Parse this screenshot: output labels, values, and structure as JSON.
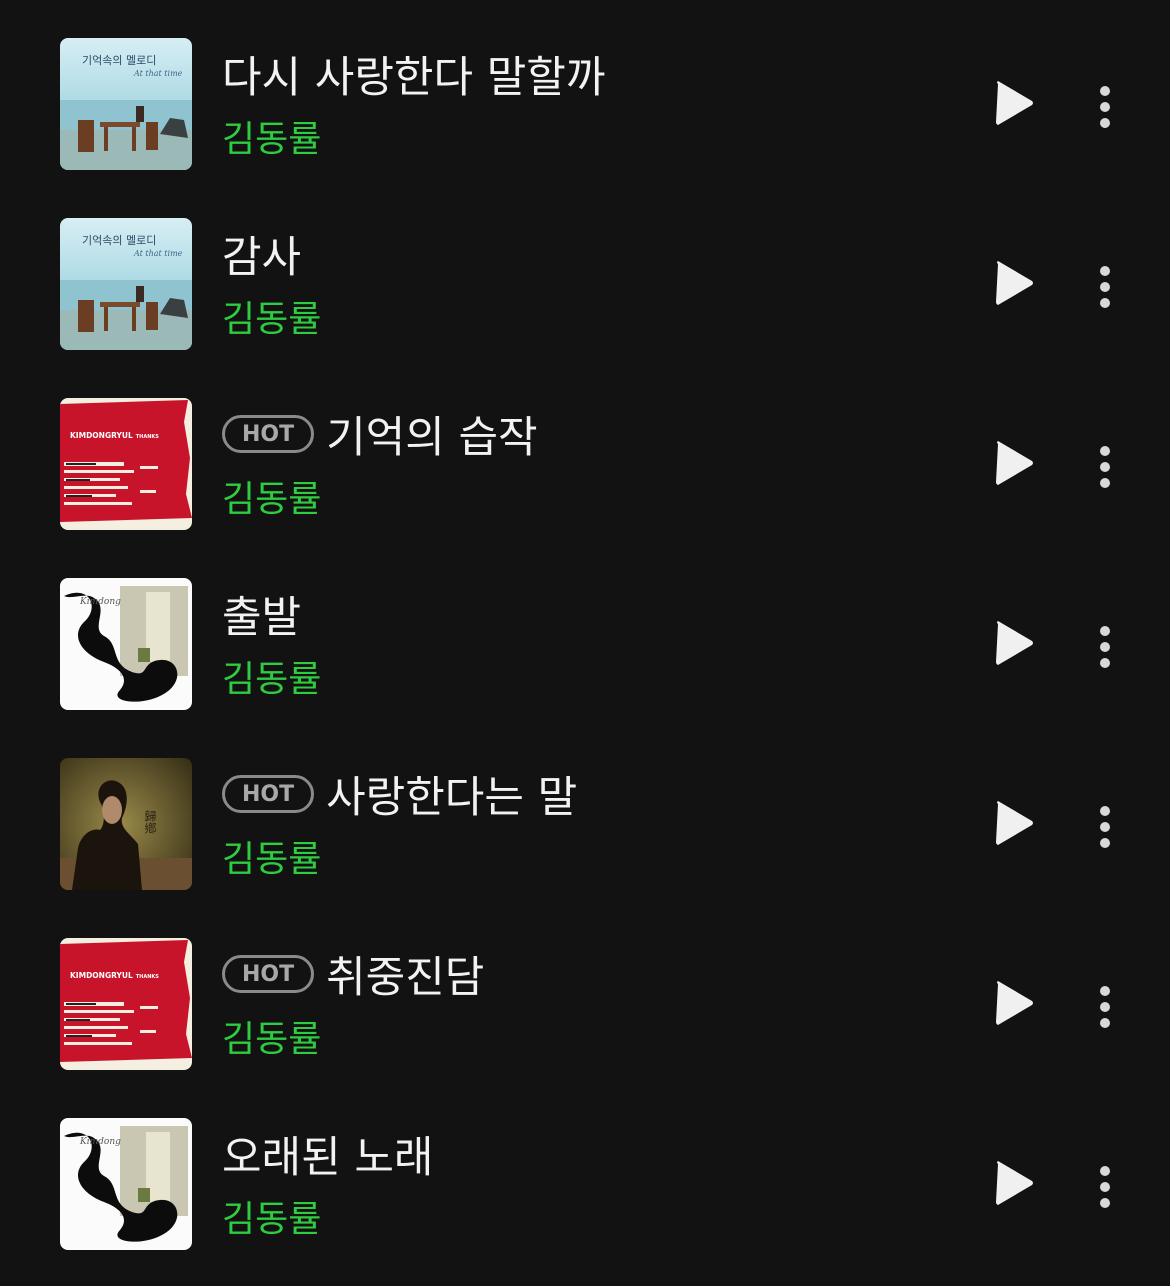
{
  "hot_label": "HOT",
  "songs": [
    {
      "title": "다시 사랑한다 말할까",
      "artist": "김동률",
      "hot": false,
      "cover": "blue-beach",
      "cover_text": "기억속의 멜로디",
      "cover_subtext": "At that time"
    },
    {
      "title": "감사",
      "artist": "김동률",
      "hot": false,
      "cover": "blue-beach",
      "cover_text": "기억속의 멜로디",
      "cover_subtext": "At that time"
    },
    {
      "title": "기억의 습작",
      "artist": "김동률",
      "hot": true,
      "cover": "red-paint",
      "cover_text": "KIMDONGRYUL",
      "cover_subtext": "THANKS"
    },
    {
      "title": "출발",
      "artist": "김동률",
      "hot": false,
      "cover": "white-ink",
      "cover_text": "Kimdong",
      "cover_subtext": ""
    },
    {
      "title": "사랑한다는 말",
      "artist": "김동률",
      "hot": true,
      "cover": "dark-portrait",
      "cover_text": "歸鄕",
      "cover_subtext": ""
    },
    {
      "title": "취중진담",
      "artist": "김동률",
      "hot": true,
      "cover": "red-paint",
      "cover_text": "KIMDONGRYUL",
      "cover_subtext": "THANKS"
    },
    {
      "title": "오래된 노래",
      "artist": "김동률",
      "hot": false,
      "cover": "white-ink",
      "cover_text": "Kimdong",
      "cover_subtext": ""
    }
  ],
  "icons": {
    "play": "play-icon",
    "more": "more-vertical-icon"
  },
  "colors": {
    "background": "#121212",
    "title": "#f2f2f2",
    "artist": "#2ecc40",
    "hot_border": "#8a8a8a"
  }
}
